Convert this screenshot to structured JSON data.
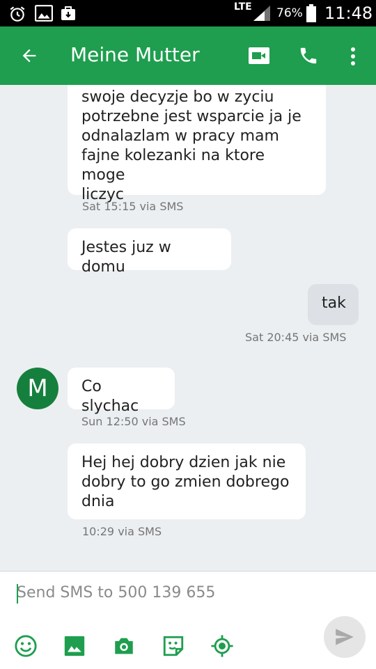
{
  "status_bar": {
    "network": "LTE",
    "battery": "76%",
    "time": "11:48"
  },
  "header": {
    "back_icon": "arrow-back-icon",
    "title": "Meine Mutter",
    "video_icon": "video-call-icon",
    "phone_icon": "phone-icon",
    "menu_icon": "more-vert-icon"
  },
  "messages": [
    {
      "direction": "incoming",
      "text": "swoje decyzje bo w zyciu potrzebne jest wsparcie ja je odnalazlam w pracy mam fajne kolezanki na ktore moge liczyc",
      "lines": [
        "swoje decyzje bo w zyciu",
        "potrzebne jest wsparcie ja je",
        "odnalazlam w pracy mam",
        "fajne kolezanki na ktore moge",
        "liczyc"
      ],
      "meta": "Sat 15:15 via SMS"
    },
    {
      "direction": "incoming",
      "text": "Jestes juz w domu",
      "meta": ""
    },
    {
      "direction": "outgoing",
      "text": "tak",
      "meta": "Sat 20:45 via SMS"
    },
    {
      "direction": "incoming",
      "avatar_letter": "M",
      "text": "Co slychac",
      "meta": "Sun 12:50 via SMS"
    },
    {
      "direction": "incoming",
      "lines": [
        "Hej hej dobry dzien jak nie",
        "dobry to go zmien dobrego",
        "dnia"
      ],
      "meta": "10:29 via SMS"
    }
  ],
  "composer": {
    "placeholder": "Send SMS to 500 139 655",
    "tools": [
      "emoji-icon",
      "image-icon",
      "camera-icon",
      "sticker-icon",
      "location-icon"
    ],
    "send_icon": "send-icon"
  },
  "colors": {
    "accent": "#1e9e4e",
    "avatar": "#15803d",
    "incoming_bubble": "#ffffff",
    "outgoing_bubble": "#dde1e5",
    "background": "#eceff1"
  }
}
